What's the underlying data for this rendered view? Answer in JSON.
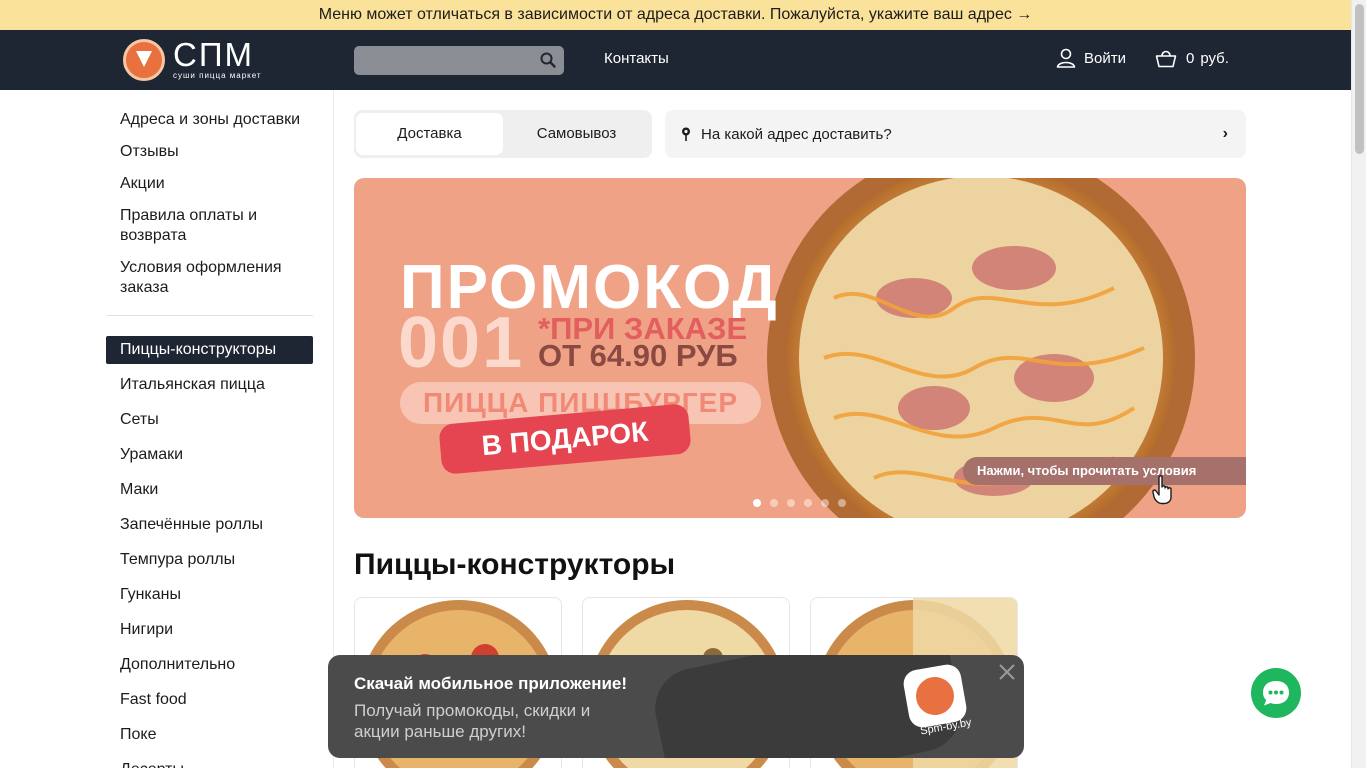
{
  "notice": {
    "text": "Меню может отличаться в зависимости от адреса доставки. Пожалуйста, укажите ваш адрес →"
  },
  "header": {
    "logo_word": "СПМ",
    "logo_tagline": "суши пицца маркет",
    "search_placeholder": "",
    "contacts_label": "Контакты",
    "login_label": "Войти",
    "cart_count": "0",
    "cart_currency": "руб."
  },
  "sidebar": {
    "info_links": [
      "Адреса и зоны доставки",
      "Отзывы",
      "Акции",
      "Правила оплаты и возврата",
      "Условия оформления заказа"
    ],
    "categories": [
      "Пиццы-конструкторы",
      "Итальянская пицца",
      "Сеты",
      "Урамаки",
      "Маки",
      "Запечённые роллы",
      "Темпура роллы",
      "Гунканы",
      "Нигири",
      "Дополнительно",
      "Fast food",
      "Поке",
      "Десерты"
    ],
    "active_category": "Пиццы-конструкторы"
  },
  "delivery": {
    "modes": [
      "Доставка",
      "Самовывоз"
    ],
    "active_mode": "Доставка",
    "address_prompt": "На какой адрес доставить?"
  },
  "banner": {
    "title": "ПРОМОКОД",
    "code": "001",
    "condition_line1": "*ПРИ ЗАКАЗЕ",
    "condition_line2": "ОТ 64.90 РУБ",
    "pizza_name": "ПИЦЦА ПИЦЦБУРГЕР",
    "gift": "В ПОДАРОК",
    "hint": "Нажми, чтобы прочитать условия",
    "slides_total": 6,
    "slide_active": 1
  },
  "section": {
    "title": "Пиццы-конструкторы"
  },
  "app_popup": {
    "title": "Скачай мобильное приложение!",
    "text": "Получай промокоды, скидки и акции раньше других!",
    "domain": "Spm-by.by"
  },
  "colors": {
    "header_bg": "#1f2633",
    "notice_bg": "#fbe29b",
    "banner_bg": "#f0a286",
    "chat_green": "#1fb75d",
    "gift_red": "#e54550"
  },
  "icons": [
    "search-icon",
    "user-icon",
    "cart-icon",
    "location-pin-icon",
    "chevron-right-icon",
    "hand-pointer-icon",
    "close-icon",
    "chat-icon"
  ]
}
